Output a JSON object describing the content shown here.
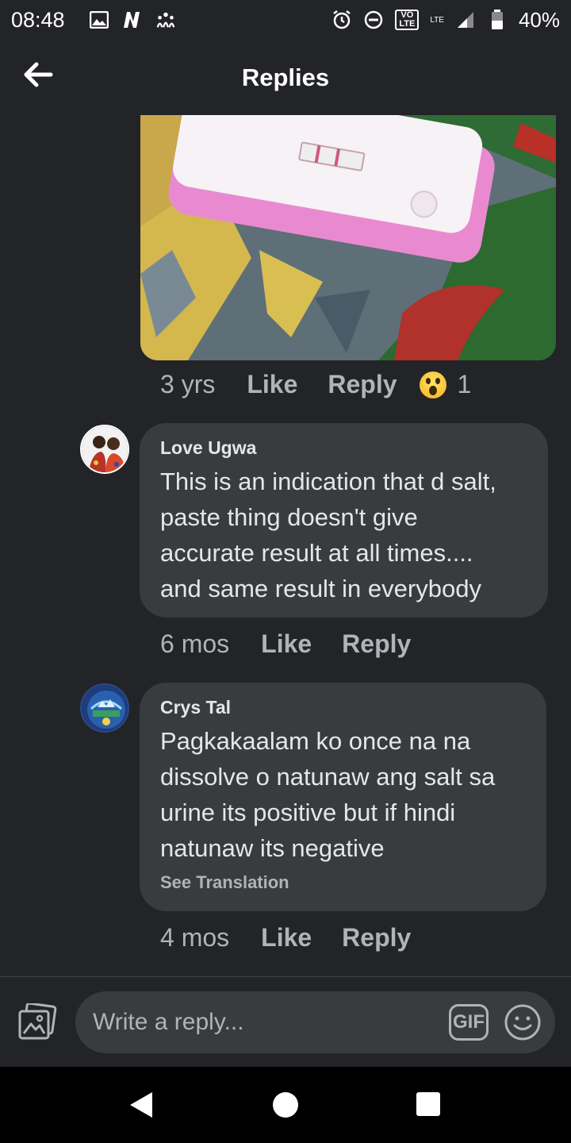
{
  "status_bar": {
    "time": "08:48",
    "volte_label": "VO\nLTE",
    "lte_label": "LTE",
    "battery": "40%"
  },
  "header": {
    "title": "Replies"
  },
  "first_reply_actions": {
    "time": "3 yrs",
    "like": "Like",
    "reply": "Reply",
    "reaction_count": "1",
    "reaction_icon": "wow-emoji-icon"
  },
  "comments": [
    {
      "author": "Love Ugwa",
      "text_lines": [
        "This is an indication that d salt,",
        "paste thing doesn't give",
        "accurate result at all times....",
        "and same result in everybody"
      ],
      "time": "6 mos",
      "like": "Like",
      "reply": "Reply"
    },
    {
      "author": "Crys Tal",
      "text_lines": [
        "Pagkakaalam ko once na na",
        "dissolve o natunaw ang salt sa",
        "urine its positive but if hindi",
        "natunaw its negative"
      ],
      "see_translation": "See Translation",
      "time": "4 mos",
      "like": "Like",
      "reply": "Reply"
    }
  ],
  "composer": {
    "placeholder": "Write a reply...",
    "gif_label": "GIF"
  },
  "colors": {
    "background": "#232427",
    "bubble": "#3a3b3e",
    "text_primary": "#e4e6eb",
    "text_secondary": "#b0b3b8"
  }
}
